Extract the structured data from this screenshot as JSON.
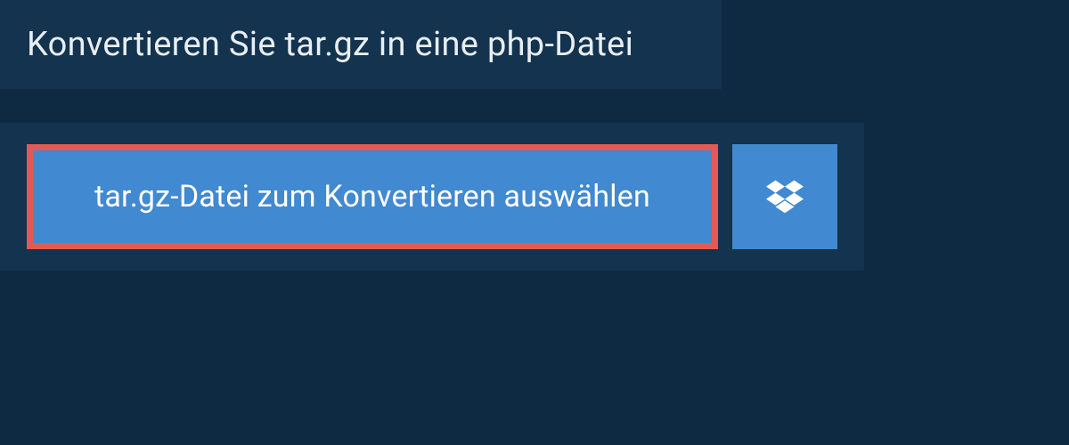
{
  "header": {
    "title": "Konvertieren Sie tar.gz in eine php-Datei"
  },
  "upload": {
    "file_select_label": "tar.gz-Datei zum Konvertieren auswählen",
    "dropbox_icon_name": "dropbox"
  },
  "colors": {
    "background": "#0e2a42",
    "panel": "#14334f",
    "button": "#4189d0",
    "highlight_border": "#e15b52",
    "text_light": "#e8eef3",
    "text_white": "#ffffff"
  }
}
